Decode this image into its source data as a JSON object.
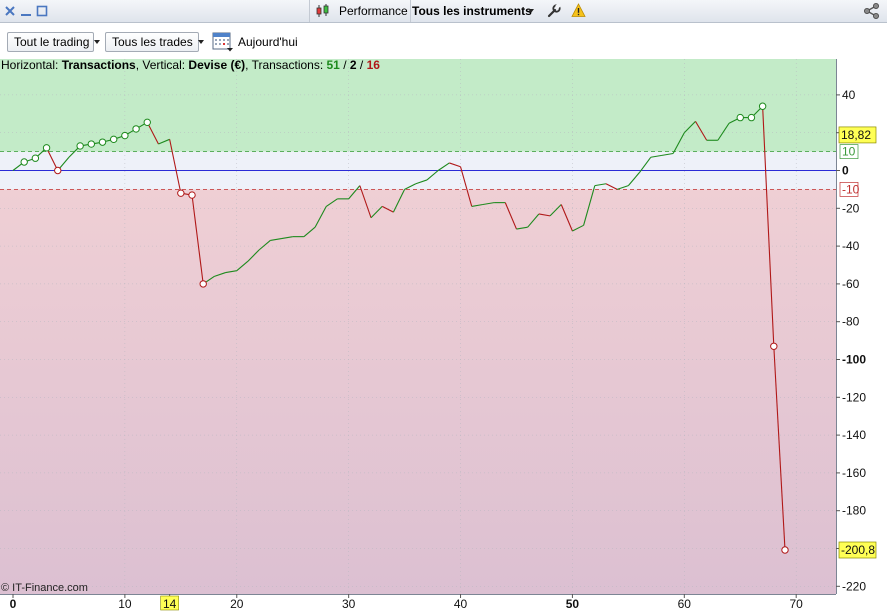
{
  "window": {
    "performance_label": "Performance",
    "instrument_select": "Tous les instruments"
  },
  "toolbar": {
    "trading_filter": "Tout le trading",
    "trades_filter": "Tous les trades",
    "today_label": "Aujourd'hui"
  },
  "info_bar": {
    "horizontal_prefix": "Horizontal: ",
    "horizontal_value": "Transactions",
    "vertical_prefix": ", Vertical: ",
    "vertical_value": "Devise (€)",
    "count_prefix": ", Transactions: ",
    "count_wins": "51",
    "sep1": " / ",
    "count_neutral": "2",
    "sep2": " / ",
    "count_losses": "16"
  },
  "watermark": "© IT-Finance.com",
  "colors": {
    "profit_zone_top": "#c3ebc8",
    "neutral_zone": "#eef1f9",
    "loss_zone_top": "#efcfd4",
    "loss_zone_bottom": "#dcc0d2",
    "up_segment": "#1d8a1d",
    "down_segment": "#b01818",
    "zero_line": "#2b2bd6",
    "marker_highlight": "#ffff55"
  },
  "chart_data": {
    "type": "line",
    "xlabel": "",
    "ylabel": "",
    "xlim": [
      0,
      73
    ],
    "ylim": [
      -225,
      55
    ],
    "x_ticks": [
      "0",
      "10",
      "14",
      "20",
      "30",
      "40",
      "50",
      "60",
      "70"
    ],
    "x_ticks_bold": [
      "0",
      "50"
    ],
    "x_highlight": "14",
    "y_ticks": [
      "40",
      "20",
      "0",
      "-20",
      "-40",
      "-60",
      "-80",
      "-100",
      "-120",
      "-140",
      "-160",
      "-180",
      "-200",
      "-220"
    ],
    "y_ticks_bold": [
      "0",
      "-100",
      "-200"
    ],
    "thresholds": [
      {
        "value": 10,
        "label": "10",
        "color": "#3a9a3a"
      },
      {
        "value": -10,
        "label": "-10",
        "color": "#c03030"
      }
    ],
    "value_markers": [
      {
        "value": 18.82,
        "label": "18,82"
      },
      {
        "value": -200.8,
        "label": "-200,8"
      }
    ],
    "series": [
      {
        "x": [
          0,
          1,
          2,
          3,
          4,
          5,
          6,
          7,
          8,
          9,
          10,
          11,
          12,
          13,
          14,
          15,
          16,
          17,
          18,
          19,
          20,
          21,
          22,
          23,
          24,
          25,
          26,
          27,
          28,
          29,
          30,
          31,
          32,
          33,
          34,
          35,
          36,
          37,
          38,
          39,
          40,
          41,
          42,
          43,
          44,
          45,
          46,
          47,
          48,
          49,
          50,
          51,
          52,
          53,
          54,
          55,
          56,
          57,
          58,
          59,
          60,
          61,
          62,
          63,
          64,
          65,
          66,
          67,
          68,
          69
        ],
        "y": [
          0,
          4.5,
          6.5,
          12,
          0,
          7,
          13,
          14,
          15,
          16.5,
          18.5,
          22,
          25.5,
          14,
          16.5,
          -12,
          -13,
          -60,
          -56,
          -54,
          -53,
          -48,
          -42,
          -37,
          -36,
          -35,
          -35,
          -30,
          -19,
          -15,
          -15,
          -8,
          -25,
          -19,
          -22,
          -10,
          -7,
          -5,
          0,
          4,
          2,
          -19,
          -18,
          -17,
          -17,
          -31,
          -30,
          -23,
          -24,
          -18,
          -32,
          -29,
          -8,
          -7,
          -10,
          -8,
          -1,
          7,
          8,
          9,
          20,
          26,
          16,
          16,
          25,
          28,
          28,
          34,
          -93,
          -200.8
        ],
        "markers": [
          1,
          2,
          3,
          4,
          6,
          7,
          8,
          9,
          10,
          11,
          12,
          15,
          16,
          17,
          65,
          66,
          67,
          68,
          69
        ]
      }
    ]
  }
}
